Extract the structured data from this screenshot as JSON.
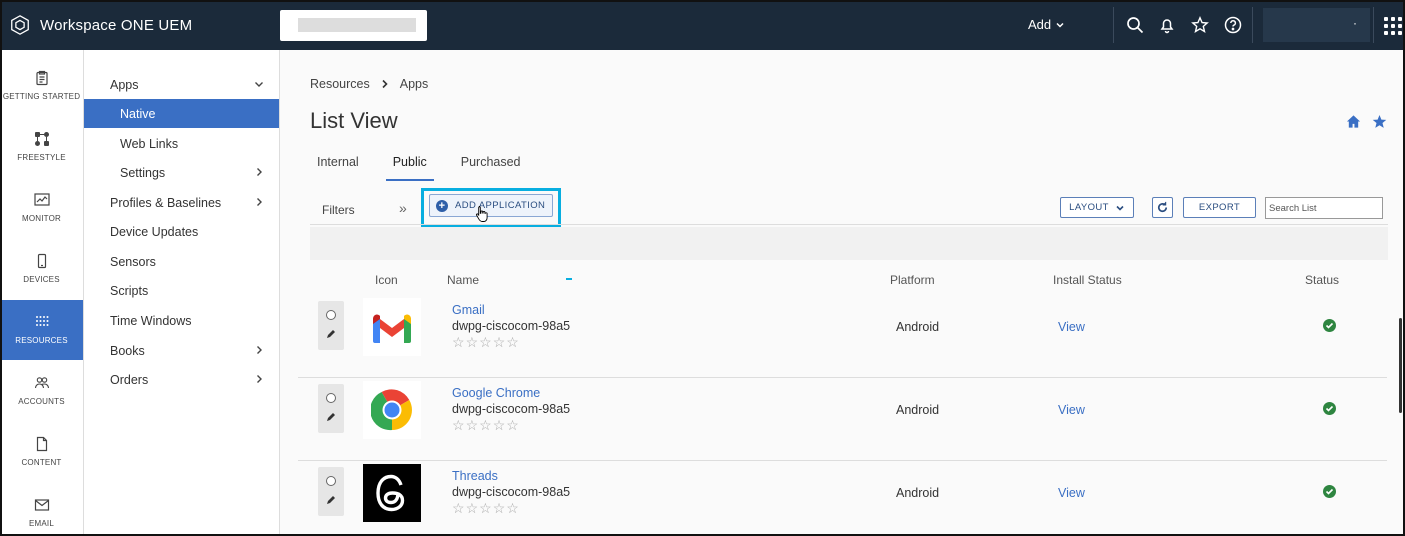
{
  "app": {
    "title": "Workspace ONE UEM"
  },
  "topbar": {
    "add_label": "Add",
    "user_dot": "·"
  },
  "rail": [
    {
      "label": "GETTING STARTED",
      "icon": "clipboard-icon"
    },
    {
      "label": "FREESTYLE",
      "icon": "freestyle-icon"
    },
    {
      "label": "MONITOR",
      "icon": "monitor-icon"
    },
    {
      "label": "DEVICES",
      "icon": "device-icon"
    },
    {
      "label": "RESOURCES",
      "icon": "resources-icon",
      "active": true
    },
    {
      "label": "ACCOUNTS",
      "icon": "accounts-icon"
    },
    {
      "label": "CONTENT",
      "icon": "content-icon"
    },
    {
      "label": "EMAIL",
      "icon": "email-icon"
    }
  ],
  "nav": {
    "items": [
      {
        "label": "Apps",
        "chevron": "down"
      },
      {
        "label": "Native",
        "sub": true,
        "active": true
      },
      {
        "label": "Web Links",
        "sub": true
      },
      {
        "label": "Settings",
        "sub": true,
        "chevron": "right"
      },
      {
        "label": "Profiles & Baselines",
        "chevron": "right"
      },
      {
        "label": "Device Updates"
      },
      {
        "label": "Sensors"
      },
      {
        "label": "Scripts"
      },
      {
        "label": "Time Windows"
      },
      {
        "label": "Books",
        "chevron": "right"
      },
      {
        "label": "Orders",
        "chevron": "right"
      }
    ]
  },
  "breadcrumb": {
    "root": "Resources",
    "current": "Apps"
  },
  "page": {
    "title": "List View"
  },
  "tabs": [
    {
      "label": "Internal"
    },
    {
      "label": "Public",
      "active": true
    },
    {
      "label": "Purchased"
    }
  ],
  "toolbar": {
    "filters_label": "Filters",
    "expand_glyph": "»",
    "add_application_label": "ADD APPLICATION",
    "layout_label": "LAYOUT",
    "export_label": "EXPORT",
    "search_placeholder": "Search List"
  },
  "table": {
    "headers": {
      "icon": "Icon",
      "name": "Name",
      "platform": "Platform",
      "install_status": "Install Status",
      "status": "Status"
    },
    "rows": [
      {
        "name": "Gmail",
        "id": "dwpg-ciscocom-98a5",
        "platform": "Android",
        "install_status": "View",
        "icon": "gmail-icon",
        "rating": 0
      },
      {
        "name": "Google Chrome",
        "id": "dwpg-ciscocom-98a5",
        "platform": "Android",
        "install_status": "View",
        "icon": "chrome-icon",
        "rating": 0
      },
      {
        "name": "Threads",
        "id": "dwpg-ciscocom-98a5",
        "platform": "Android",
        "install_status": "View",
        "icon": "threads-icon",
        "rating": 0
      }
    ]
  },
  "colors": {
    "topbar": "#1b2a3a",
    "accent": "#3a6fc4",
    "highlight": "#08aee0",
    "success": "#2e8540"
  }
}
